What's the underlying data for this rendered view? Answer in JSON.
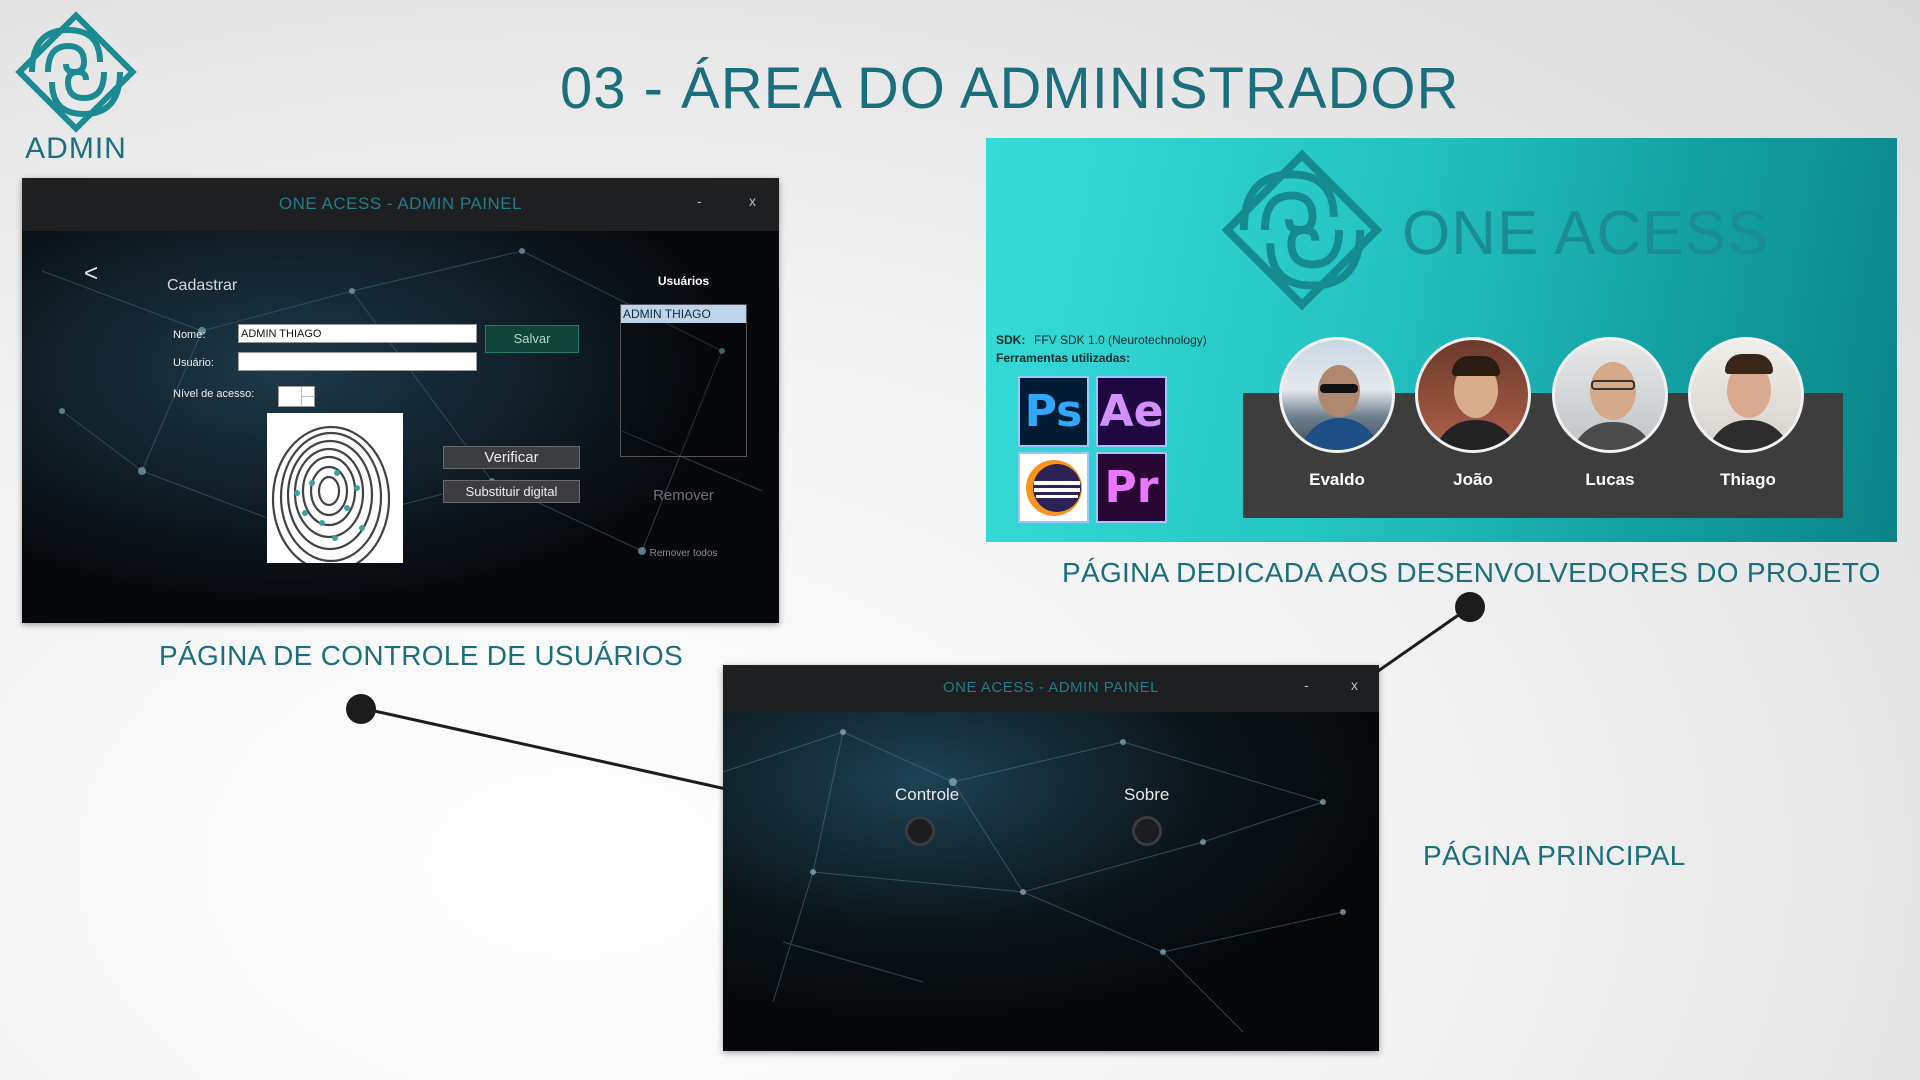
{
  "header": {
    "logo_text": "ADMIN",
    "title": "03 - ÁREA DO ADMINISTRADOR"
  },
  "control_window": {
    "title": "ONE ACESS - ADMIN PAINEL",
    "minimize_glyph": "-",
    "close_glyph": "x",
    "back_glyph": "<",
    "section_title": "Cadastrar",
    "name_label": "Nome:",
    "name_value": "ADMIN THIAGO",
    "user_label": "Usuário:",
    "user_value": "",
    "access_label": "Nível de acesso:",
    "save_button": "Salvar",
    "verify_button": "Verificar",
    "replace_button": "Substituir digital",
    "users_title": "Usuários",
    "users": [
      "ADMIN THIAGO"
    ],
    "remove_button": "Remover",
    "remove_all_button": "Remover todos"
  },
  "main_window": {
    "title": "ONE ACESS - ADMIN PAINEL",
    "minimize_glyph": "-",
    "close_glyph": "x",
    "nav": {
      "control_label": "Controle",
      "about_label": "Sobre"
    }
  },
  "dev_page": {
    "brand": "ONE ACESS",
    "sdk_label": "SDK:",
    "sdk_value": "FFV SDK 1.0 (Neurotechnology)",
    "tools_label": "Ferramentas utilizadas:",
    "tools": [
      {
        "icon": "photoshop-icon",
        "label": "Ps",
        "color": "#31a8ff"
      },
      {
        "icon": "after-effects-icon",
        "label": "Ae",
        "color": "#d291ff"
      },
      {
        "icon": "eclipse-icon",
        "label": ""
      },
      {
        "icon": "premiere-icon",
        "label": "Pr",
        "color": "#ea77ff"
      }
    ],
    "developers": [
      "Evaldo",
      "João",
      "Lucas",
      "Thiago"
    ]
  },
  "captions": {
    "control": "PÁGINA DE CONTROLE DE USUÁRIOS",
    "developers": "PÁGINA DEDICADA AOS DESENVOLVEDORES DO PROJETO",
    "main": "PÁGINA PRINCIPAL"
  },
  "colors": {
    "accent": "#1b6f7c",
    "brand_teal": "#1a8d92",
    "window_bg": "#07090c"
  }
}
